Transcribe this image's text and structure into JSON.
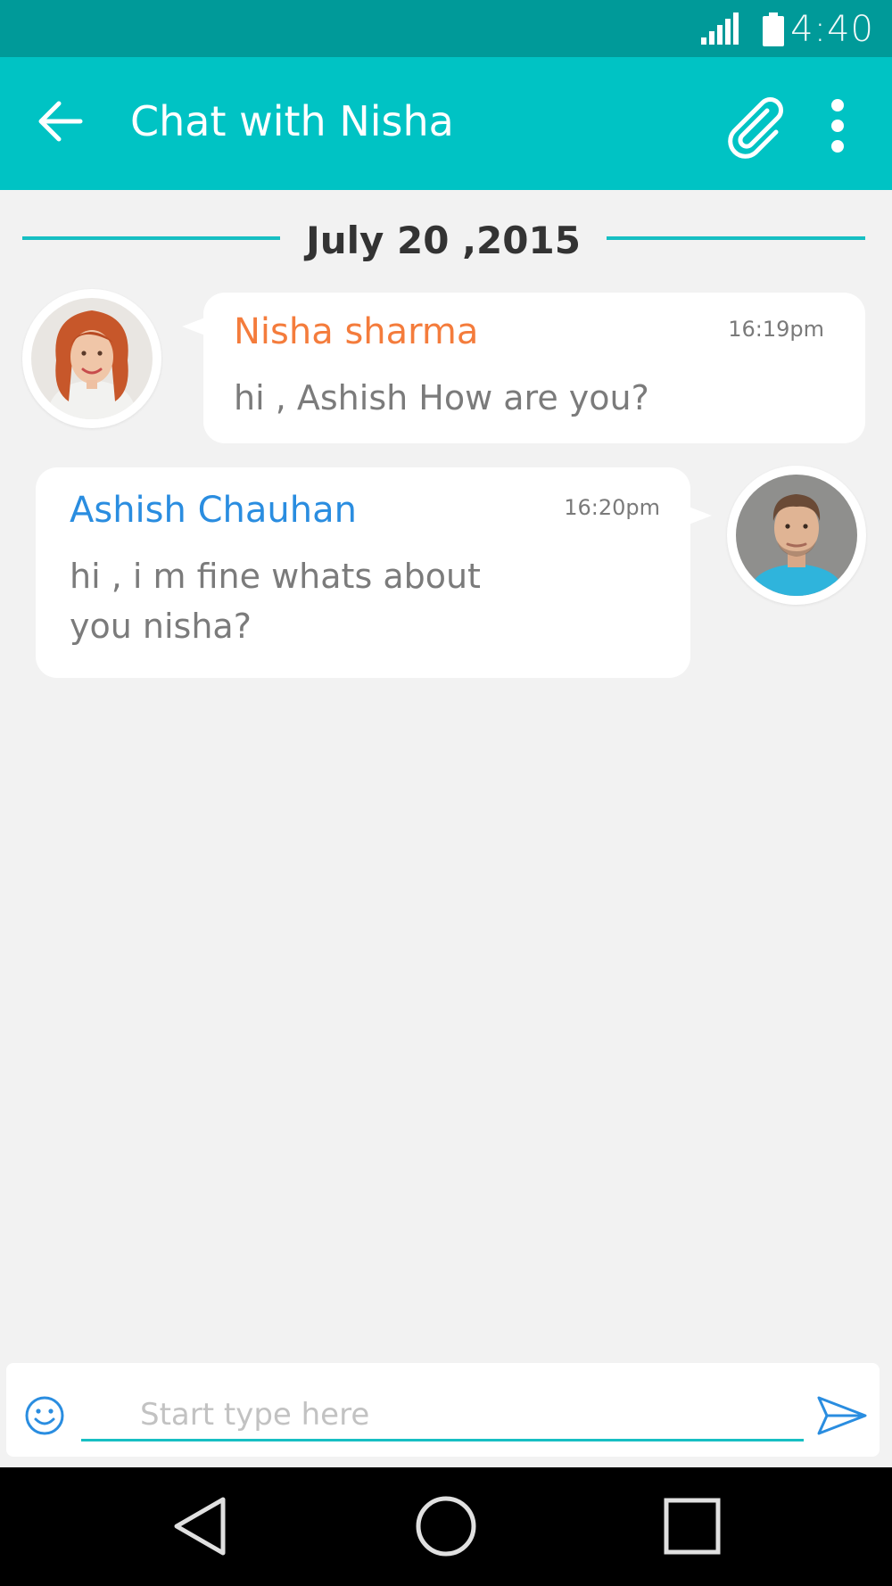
{
  "status_bar": {
    "time": "4:40",
    "icons": [
      "signal-icon",
      "battery-icon"
    ]
  },
  "app_bar": {
    "title": "Chat with Nisha",
    "icons": [
      "back-arrow-icon",
      "paperclip-icon",
      "more-vert-icon"
    ]
  },
  "chat": {
    "date": "July 20 ,2015",
    "messages": [
      {
        "sender": "Nisha sharma",
        "time": "16:19pm",
        "text": "hi , Ashish How are you?",
        "sender_color": "#f47c3c",
        "avatar": "female-avatar"
      },
      {
        "sender": "Ashish Chauhan",
        "time": "16:20pm",
        "text": "hi , i m fine whats about\nyou nisha?",
        "sender_color": "#2a8de0",
        "avatar": "male-avatar"
      }
    ]
  },
  "composer": {
    "placeholder": "Start type here",
    "value": "",
    "icons": [
      "emoji-icon",
      "send-icon"
    ]
  },
  "nav_bar": {
    "icons": [
      "nav-back-icon",
      "nav-home-icon",
      "nav-recents-icon"
    ]
  },
  "colors": {
    "status_bar": "#009a99",
    "app_bar": "#00c3c4",
    "accent": "#17bfc3",
    "background": "#f2f2f2"
  }
}
